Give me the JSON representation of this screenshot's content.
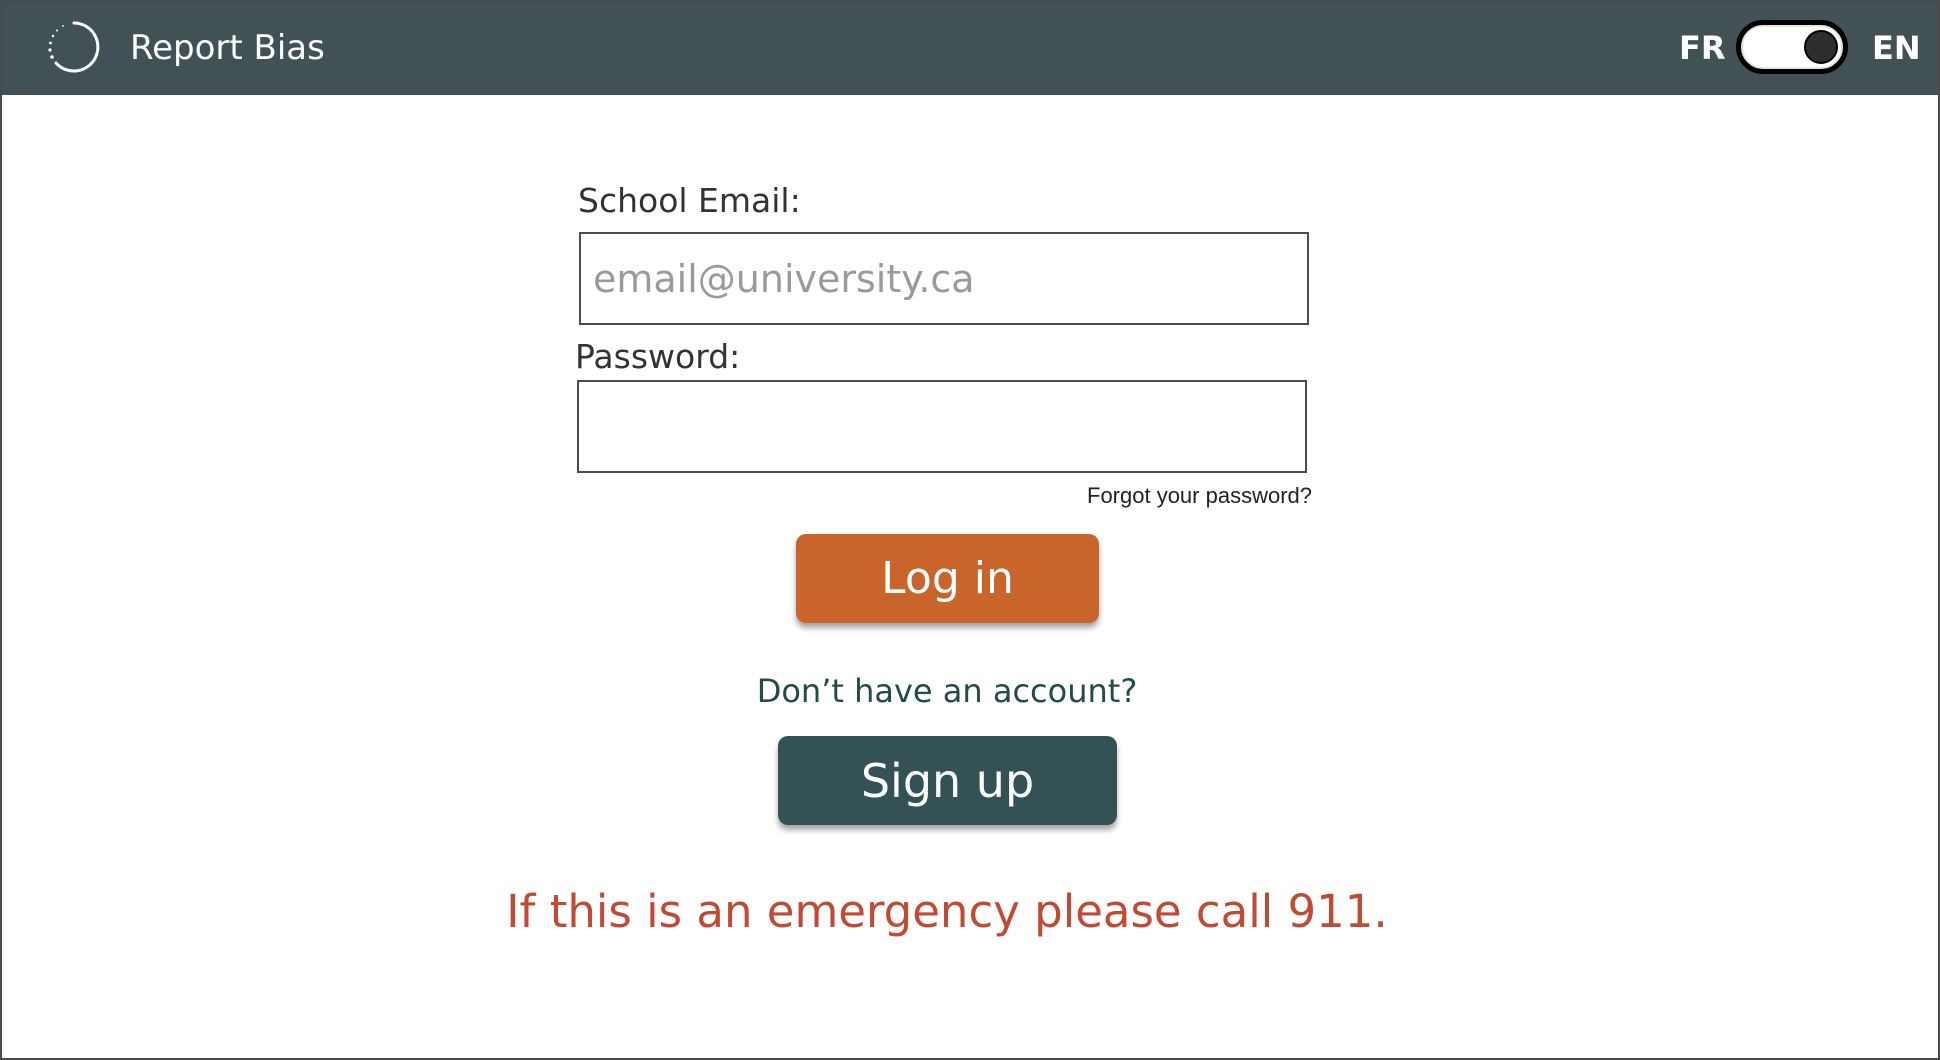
{
  "header": {
    "title": "Report Bias",
    "logo_icon": "loading-circle-icon",
    "background_color": "#415154",
    "language": {
      "left_label": "FR",
      "right_label": "EN",
      "selected": "EN"
    }
  },
  "login_form": {
    "email_label": "School Email:",
    "email_placeholder": "email@university.ca",
    "email_value": "",
    "password_label": "Password:",
    "password_value": "",
    "forgot_link": "Forgot your password?",
    "login_button": "Log in",
    "login_button_color": "#c9652b"
  },
  "signup": {
    "prompt": "Don’t have an account?",
    "button": "Sign up",
    "button_color": "#345256"
  },
  "emergency_notice": {
    "text": "If this is an emergency please call 911.",
    "color": "#c04a33"
  }
}
